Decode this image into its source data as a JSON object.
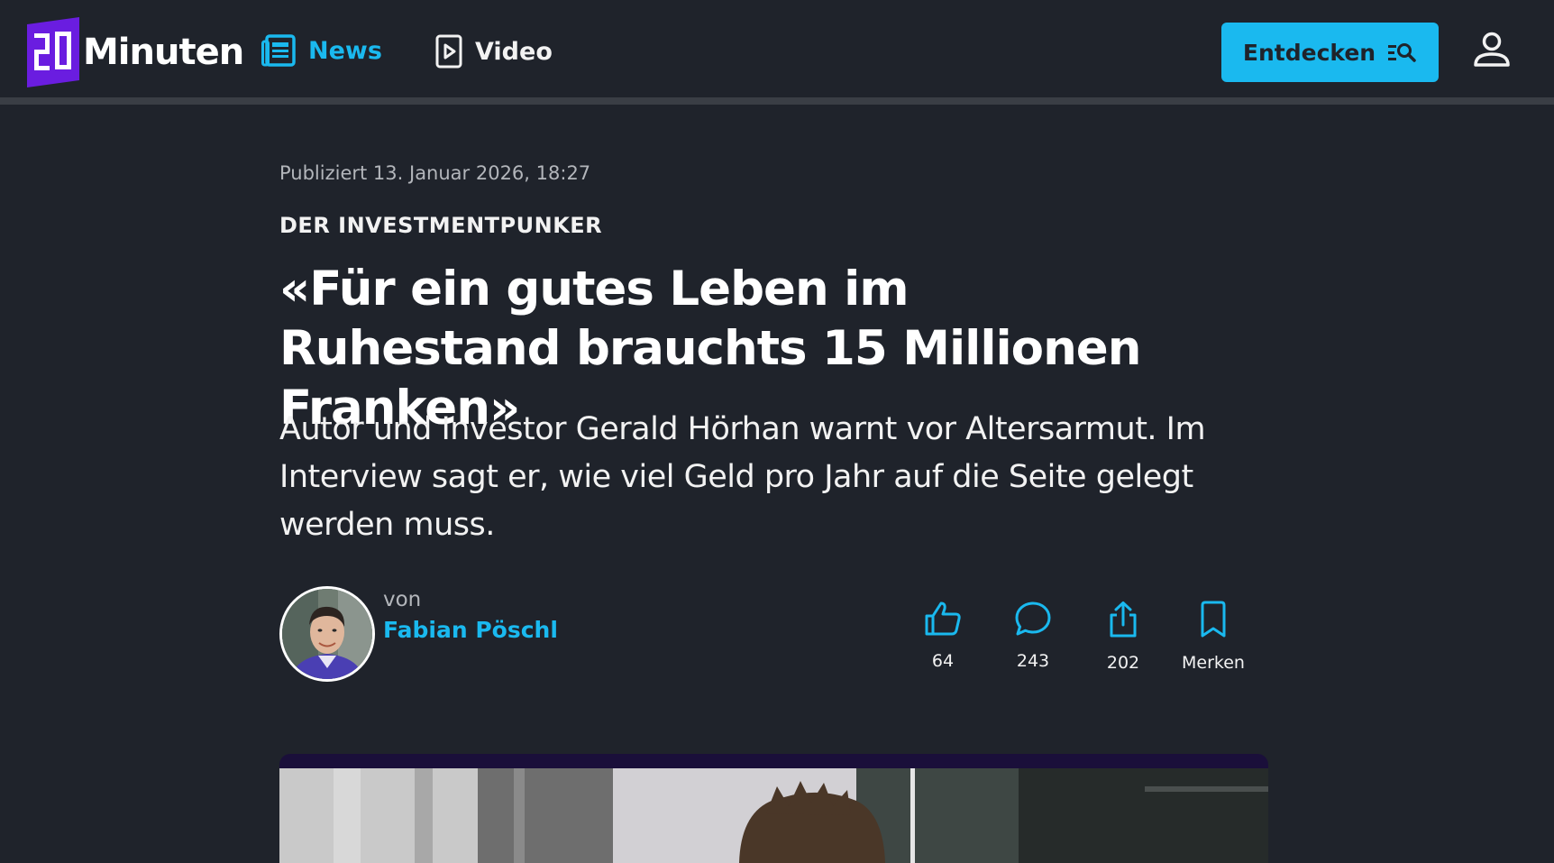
{
  "header": {
    "logo_text": "Minuten",
    "logo_number": "20",
    "nav": [
      {
        "label": "News",
        "icon": "newspaper-icon",
        "active": true
      },
      {
        "label": "Video",
        "icon": "play-icon",
        "active": false
      }
    ],
    "discover_label": "Entdecken",
    "discover_icon": "search-list-icon",
    "user_icon": "user-icon"
  },
  "colors": {
    "accent": "#1ab9ef",
    "brand": "#6a1de0",
    "background": "#1f232b"
  },
  "article": {
    "published": "Publiziert 13. Januar 2026, 18:27",
    "kicker": "DER INVESTMENTPUNKER",
    "headline": "«Für ein gutes Leben im Ruhestand brauchts 15 Millionen Franken»",
    "lead": "Autor und Investor Gerald Hörhan warnt vor Altersarmut. Im Interview sagt er, wie viel Geld pro Jahr auf die Seite gelegt werden muss.",
    "author": {
      "by_label": "von",
      "name": "Fabian Pöschl"
    },
    "actions": {
      "likes": "64",
      "comments": "243",
      "shares": "202",
      "save_label": "Merken"
    }
  }
}
